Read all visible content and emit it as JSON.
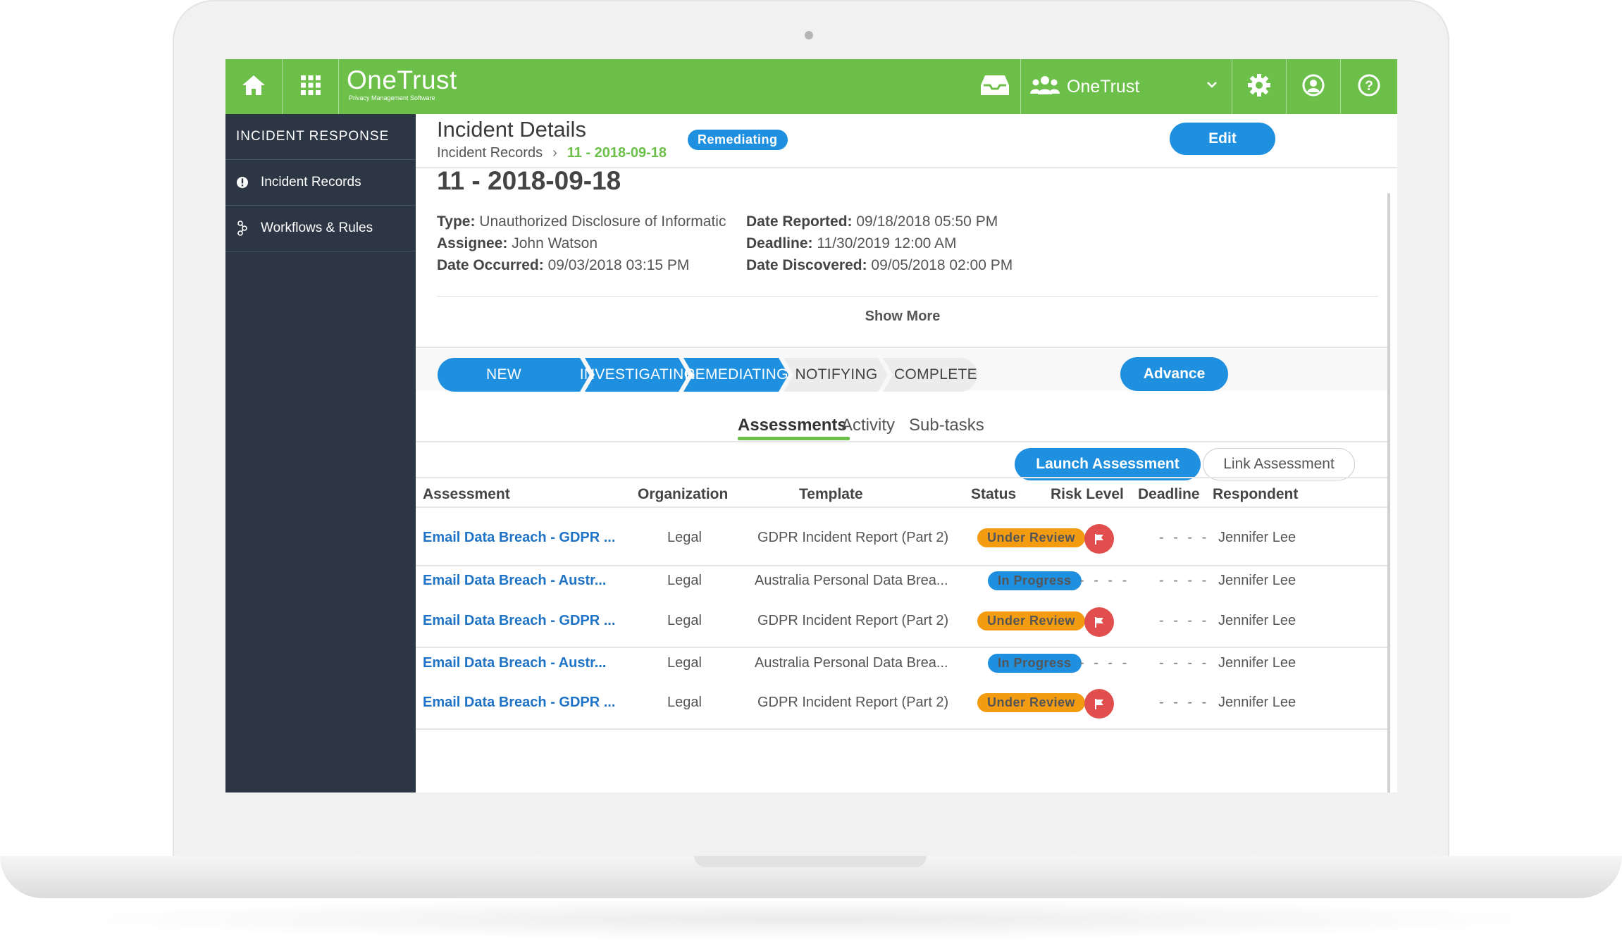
{
  "app": {
    "brand": "OneTrust",
    "brand_sub": "Privacy Management Software",
    "org": "OneTrust"
  },
  "colors": {
    "topbar": "#6cc04a",
    "sidebar": "#2c3644",
    "primary": "#1f8fdf",
    "warning": "#f39c12",
    "danger": "#e04e4e",
    "accent_green": "#6cc04a"
  },
  "topbar": {
    "icons": [
      "home-icon",
      "apps-grid-icon",
      "inbox-icon",
      "users-icon",
      "chevron-down-icon",
      "gear-icon",
      "user-circle-icon",
      "help-icon"
    ]
  },
  "sidebar": {
    "title": "INCIDENT RESPONSE",
    "items": [
      {
        "label": "Incident Records",
        "icon": "alert-circle-icon"
      },
      {
        "label": "Workflows & Rules",
        "icon": "workflow-icon"
      }
    ]
  },
  "header": {
    "title": "Incident Details",
    "badge": "Remediating",
    "breadcrumb": [
      "Incident Records",
      "11 - 2018-09-18"
    ],
    "edit_label": "Edit"
  },
  "record": {
    "title": "11 - 2018-09-18",
    "fields": {
      "type_label": "Type:",
      "type_value": "Unauthorized Disclosure of Informatic",
      "assignee_label": "Assignee:",
      "assignee_value": "John Watson",
      "occurred_label": "Date Occurred:",
      "occurred_value": "09/03/2018 03:15 PM",
      "reported_label": "Date Reported:",
      "reported_value": "09/18/2018 05:50 PM",
      "deadline_label": "Deadline:",
      "deadline_value": "11/30/2019 12:00 AM",
      "discovered_label": "Date Discovered:",
      "discovered_value": "09/05/2018 02:00 PM"
    },
    "show_more": "Show More"
  },
  "stages": {
    "items": [
      "NEW",
      "INVESTIGATING",
      "REMEDIATING",
      "NOTIFYING",
      "COMPLETE"
    ],
    "completed_count": 3,
    "advance_label": "Advance"
  },
  "tabs": {
    "items": [
      "Assessments",
      "Activity",
      "Sub-tasks"
    ],
    "active": "Assessments"
  },
  "actions": {
    "launch": "Launch Assessment",
    "link": "Link Assessment"
  },
  "table": {
    "columns": [
      "Assessment",
      "Organization",
      "Template",
      "Status",
      "Risk Level",
      "Deadline",
      "Respondent"
    ],
    "rows": [
      {
        "assessment": "Email Data Breach - GDPR ...",
        "organization": "Legal",
        "template": "GDPR Incident Report (Part 2)",
        "status": "Under Review",
        "risk": "flag",
        "deadline": "- - - -",
        "respondent": "Jennifer Lee"
      },
      {
        "assessment": "Email Data Breach - Austr...",
        "organization": "Legal",
        "template": "Australia Personal Data Brea...",
        "status": "In Progress",
        "risk": "- - - -",
        "deadline": "- - - -",
        "respondent": "Jennifer Lee"
      },
      {
        "assessment": "Email Data Breach - GDPR ...",
        "organization": "Legal",
        "template": "GDPR Incident Report (Part 2)",
        "status": "Under Review",
        "risk": "flag",
        "deadline": "- - - -",
        "respondent": "Jennifer Lee"
      },
      {
        "assessment": "Email Data Breach - Austr...",
        "organization": "Legal",
        "template": "Australia Personal Data Brea...",
        "status": "In Progress",
        "risk": "- - - -",
        "deadline": "- - - -",
        "respondent": "Jennifer Lee"
      },
      {
        "assessment": "Email Data Breach - GDPR ...",
        "organization": "Legal",
        "template": "GDPR Incident Report (Part 2)",
        "status": "Under Review",
        "risk": "flag",
        "deadline": "- - - -",
        "respondent": "Jennifer Lee"
      }
    ]
  }
}
